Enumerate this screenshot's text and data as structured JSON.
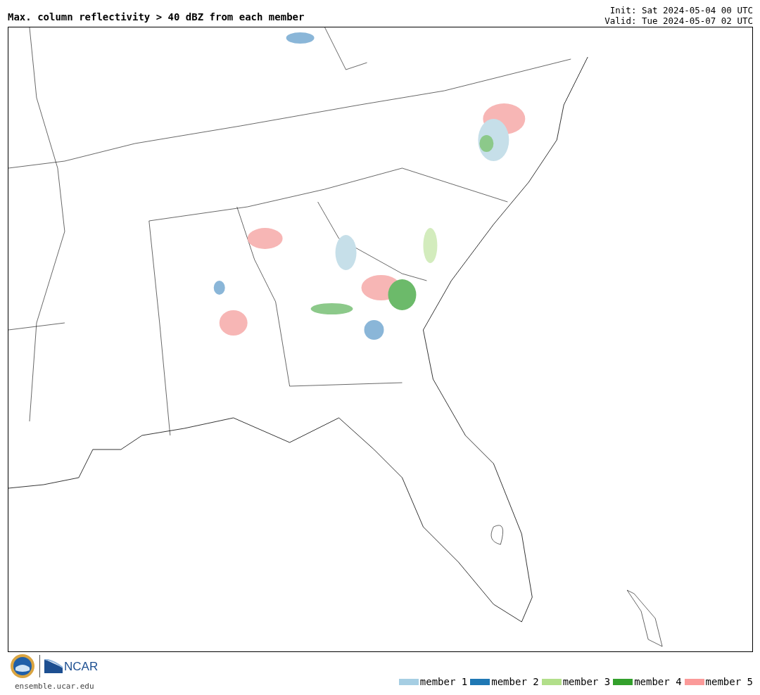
{
  "title": "Max. column reflectivity > 40 dBZ from each member",
  "init": "Init: Sat 2024-05-04 00 UTC",
  "valid": "Valid: Tue 2024-05-07 02 UTC",
  "logo": {
    "org": "NCAR"
  },
  "url": "ensemble.ucar.edu",
  "legend": [
    {
      "label": "member 1",
      "color": "#a6cee3"
    },
    {
      "label": "member 2",
      "color": "#1f78b4"
    },
    {
      "label": "member 3",
      "color": "#b2df8a"
    },
    {
      "label": "member 4",
      "color": "#33a02c"
    },
    {
      "label": "member 5",
      "color": "#fb9a99"
    }
  ]
}
